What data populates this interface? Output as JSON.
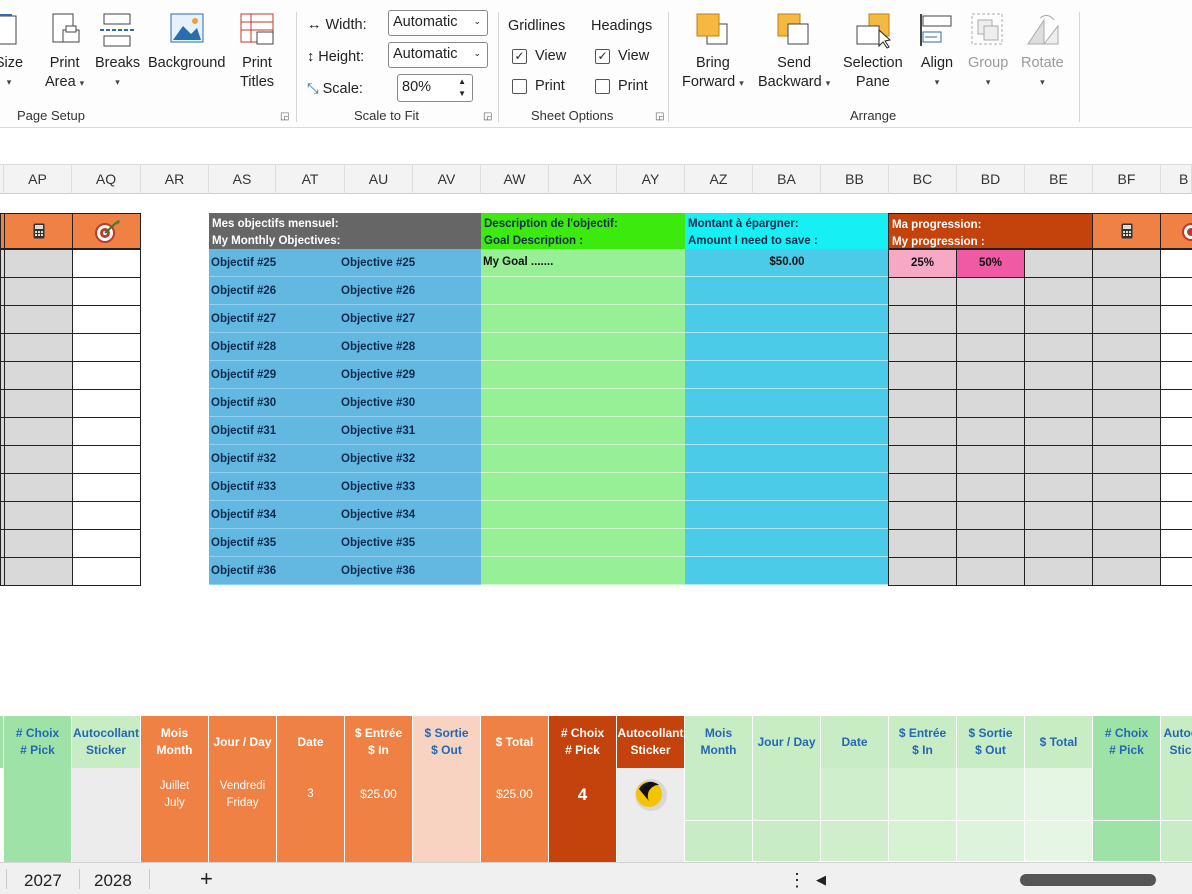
{
  "ribbon": {
    "page_setup": {
      "size_label": "Size",
      "print_area_label": "Print",
      "print_area_label2": "Area",
      "breaks_label": "Breaks",
      "background_label": "Background",
      "print_titles_label": "Print",
      "print_titles_label2": "Titles",
      "group_label": "Page Setup"
    },
    "scale_to_fit": {
      "width_label": "Width:",
      "width_value": "Automatic",
      "height_label": "Height:",
      "height_value": "Automatic",
      "scale_label": "Scale:",
      "scale_value": "80%",
      "group_label": "Scale to Fit"
    },
    "sheet_options": {
      "gridlines_label": "Gridlines",
      "headings_label": "Headings",
      "view_label": "View",
      "print_label": "Print",
      "gridlines_view_checked": true,
      "gridlines_print_checked": false,
      "headings_view_checked": true,
      "headings_print_checked": false,
      "group_label": "Sheet Options"
    },
    "arrange": {
      "bring_forward_1": "Bring",
      "bring_forward_2": "Forward",
      "send_backward_1": "Send",
      "send_backward_2": "Backward",
      "selection_pane_1": "Selection",
      "selection_pane_2": "Pane",
      "align_label": "Align",
      "group_label_btn": "Group",
      "rotate_label": "Rotate",
      "group_label": "Arrange"
    }
  },
  "columns": [
    "AP",
    "AQ",
    "AR",
    "AS",
    "AT",
    "AU",
    "AV",
    "AW",
    "AX",
    "AY",
    "AZ",
    "BA",
    "BB",
    "BC",
    "BD",
    "BE",
    "BF",
    "B"
  ],
  "objectives": {
    "header_line1": "Mes objectifs mensuel:",
    "header_line2": "My Monthly Objectives:",
    "desc_line1": "Description de l'objectif:",
    "desc_line2": "Goal Description :",
    "amount_line1": "Montant à épargner:",
    "amount_line2": "Amount I need to save :",
    "progress_line1": "Ma progression:",
    "progress_line2": "My progression :",
    "first_goal": "My Goal .......",
    "first_amount": "$50.00",
    "progress_values": [
      "25%",
      "50%"
    ],
    "rows": [
      {
        "fr": "Objectif #25",
        "en": "Objective #25"
      },
      {
        "fr": "Objectif #26",
        "en": "Objective #26"
      },
      {
        "fr": "Objectif #27",
        "en": "Objective #27"
      },
      {
        "fr": "Objectif #28",
        "en": "Objective #28"
      },
      {
        "fr": "Objectif #29",
        "en": "Objective #29"
      },
      {
        "fr": "Objectif #30",
        "en": "Objective #30"
      },
      {
        "fr": "Objectif #31",
        "en": "Objective #31"
      },
      {
        "fr": "Objectif #32",
        "en": "Objective #32"
      },
      {
        "fr": "Objectif #33",
        "en": "Objective #33"
      },
      {
        "fr": "Objectif #34",
        "en": "Objective #34"
      },
      {
        "fr": "Objectif #35",
        "en": "Objective #35"
      },
      {
        "fr": "Objectif #36",
        "en": "Objective #36"
      }
    ]
  },
  "ledger": {
    "left_headers": [
      {
        "l1": "# Choix",
        "l2": "# Pick"
      },
      {
        "l1": "Autocollant",
        "l2": "Sticker"
      }
    ],
    "mid_headers": [
      {
        "l1": "Mois",
        "l2": "Month"
      },
      {
        "l1": "Jour / Day",
        "l2": ""
      },
      {
        "l1": "Date",
        "l2": ""
      },
      {
        "l1": "$ Entrée",
        "l2": "$ In"
      },
      {
        "l1": "$ Sortie",
        "l2": "$ Out"
      },
      {
        "l1": "$ Total",
        "l2": ""
      },
      {
        "l1": "# Choix",
        "l2": "# Pick"
      },
      {
        "l1": "Autocollant",
        "l2": "Sticker"
      }
    ],
    "right_headers": [
      {
        "l1": "Mois",
        "l2": "Month"
      },
      {
        "l1": "Jour / Day",
        "l2": ""
      },
      {
        "l1": "Date",
        "l2": ""
      },
      {
        "l1": "$ Entrée",
        "l2": "$ In"
      },
      {
        "l1": "$ Sortie",
        "l2": "$ Out"
      },
      {
        "l1": "$ Total",
        "l2": ""
      },
      {
        "l1": "# Choix",
        "l2": "# Pick"
      },
      {
        "l1": "Autoc",
        "l2": "Stic"
      }
    ],
    "entry": {
      "month1": "Juillet",
      "month2": "July",
      "day1": "Vendredi",
      "day2": "Friday",
      "date": "3",
      "in": "$25.00",
      "total": "$25.00",
      "pick": "4"
    }
  },
  "sheet_tabs": [
    "2027",
    "2028"
  ],
  "add_sheet_label": "+",
  "more_label": "⋮"
}
